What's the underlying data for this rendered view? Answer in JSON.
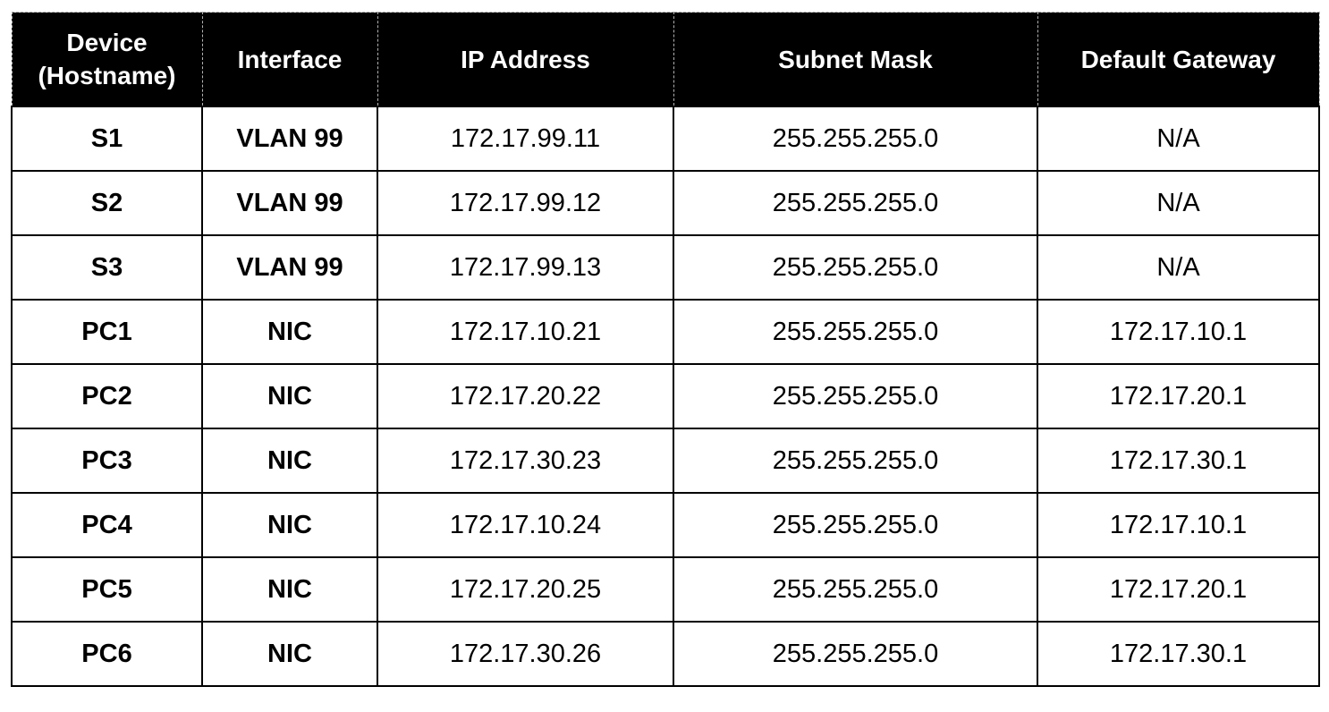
{
  "table": {
    "headers": {
      "device_line1": "Device",
      "device_line2": "(Hostname)",
      "interface": "Interface",
      "ip_address": "IP Address",
      "subnet_mask": "Subnet Mask",
      "default_gateway": "Default Gateway"
    },
    "rows": [
      {
        "device": "S1",
        "interface": "VLAN 99",
        "ip": "172.17.99.11",
        "mask": "255.255.255.0",
        "gateway": "N/A"
      },
      {
        "device": "S2",
        "interface": "VLAN 99",
        "ip": "172.17.99.12",
        "mask": "255.255.255.0",
        "gateway": "N/A"
      },
      {
        "device": "S3",
        "interface": "VLAN 99",
        "ip": "172.17.99.13",
        "mask": "255.255.255.0",
        "gateway": "N/A"
      },
      {
        "device": "PC1",
        "interface": "NIC",
        "ip": "172.17.10.21",
        "mask": "255.255.255.0",
        "gateway": "172.17.10.1"
      },
      {
        "device": "PC2",
        "interface": "NIC",
        "ip": "172.17.20.22",
        "mask": "255.255.255.0",
        "gateway": "172.17.20.1"
      },
      {
        "device": "PC3",
        "interface": "NIC",
        "ip": "172.17.30.23",
        "mask": "255.255.255.0",
        "gateway": "172.17.30.1"
      },
      {
        "device": "PC4",
        "interface": "NIC",
        "ip": "172.17.10.24",
        "mask": "255.255.255.0",
        "gateway": "172.17.10.1"
      },
      {
        "device": "PC5",
        "interface": "NIC",
        "ip": "172.17.20.25",
        "mask": "255.255.255.0",
        "gateway": "172.17.20.1"
      },
      {
        "device": "PC6",
        "interface": "NIC",
        "ip": "172.17.30.26",
        "mask": "255.255.255.0",
        "gateway": "172.17.30.1"
      }
    ]
  }
}
